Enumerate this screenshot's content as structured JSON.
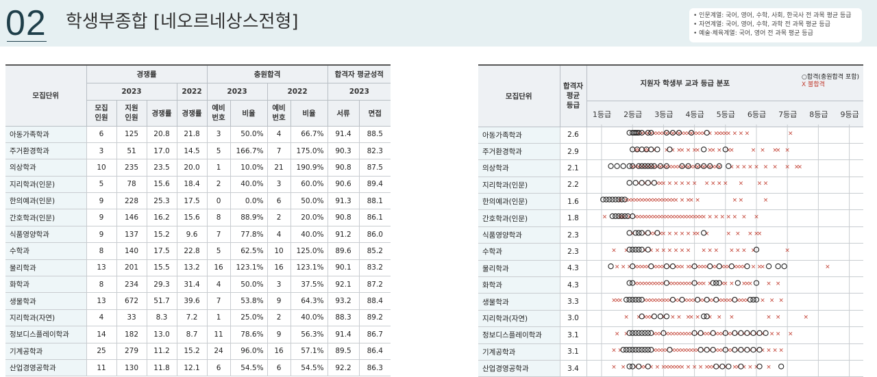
{
  "header": {
    "section_number": "02",
    "title": "학생부종합 [네오르네상스전형]",
    "notes": [
      "• 인문계열: 국어, 영어, 수학, 사회, 한국사 전 과목 평균 등급",
      "• 자연계열: 국어, 영어, 수학, 과학 전 과목 평균 등급",
      "• 예술·체육계열: 국어, 영어 전 과목 평균 등급"
    ]
  },
  "left_table": {
    "h_unit": "모집단위",
    "h_competition": "경쟁률",
    "h_additional": "충원합격",
    "h_avg": "합격자 평균성적",
    "h_2023a": "2023",
    "h_2022a": "2022",
    "h_2023b": "2023",
    "h_2022b": "2022",
    "h_2023c": "2023",
    "h_quota": "모집\n인원",
    "h_applicants": "지원\n인원",
    "h_rate": "경쟁률",
    "h_rate2022": "경쟁률",
    "h_wait": "예비\n번호",
    "h_ratio": "비율",
    "h_wait2022": "예비\n번호",
    "h_ratio2022": "비율",
    "h_doc": "서류",
    "h_interview": "면접",
    "rows": [
      [
        "아동가족학과",
        "6",
        "125",
        "20.8",
        "21.8",
        "3",
        "50.0%",
        "4",
        "66.7%",
        "91.4",
        "88.5"
      ],
      [
        "주거환경학과",
        "3",
        "51",
        "17.0",
        "14.5",
        "5",
        "166.7%",
        "7",
        "175.0%",
        "90.3",
        "82.3"
      ],
      [
        "의상학과",
        "10",
        "235",
        "23.5",
        "20.0",
        "1",
        "10.0%",
        "21",
        "190.9%",
        "90.8",
        "87.5"
      ],
      [
        "지리학과(인문)",
        "5",
        "78",
        "15.6",
        "18.4",
        "2",
        "40.0%",
        "3",
        "60.0%",
        "90.6",
        "89.4"
      ],
      [
        "한의예과(인문)",
        "9",
        "228",
        "25.3",
        "17.5",
        "0",
        "0.0%",
        "6",
        "50.0%",
        "91.3",
        "88.1"
      ],
      [
        "간호학과(인문)",
        "9",
        "146",
        "16.2",
        "15.6",
        "8",
        "88.9%",
        "2",
        "20.0%",
        "90.8",
        "86.1"
      ],
      [
        "식품영양학과",
        "9",
        "137",
        "15.2",
        "9.6",
        "7",
        "77.8%",
        "4",
        "40.0%",
        "91.2",
        "86.0"
      ],
      [
        "수학과",
        "8",
        "140",
        "17.5",
        "22.8",
        "5",
        "62.5%",
        "10",
        "125.0%",
        "89.6",
        "85.2"
      ],
      [
        "물리학과",
        "13",
        "201",
        "15.5",
        "13.2",
        "16",
        "123.1%",
        "16",
        "123.1%",
        "90.1",
        "83.2"
      ],
      [
        "화학과",
        "8",
        "234",
        "29.3",
        "31.4",
        "4",
        "50.0%",
        "3",
        "37.5%",
        "92.1",
        "87.2"
      ],
      [
        "생물학과",
        "13",
        "672",
        "51.7",
        "39.6",
        "7",
        "53.8%",
        "9",
        "64.3%",
        "93.2",
        "88.4"
      ],
      [
        "지리학과(자연)",
        "4",
        "33",
        "8.3",
        "7.2",
        "1",
        "25.0%",
        "2",
        "40.0%",
        "88.3",
        "89.2"
      ],
      [
        "정보디스플레이학과",
        "14",
        "182",
        "13.0",
        "8.7",
        "11",
        "78.6%",
        "9",
        "56.3%",
        "91.4",
        "86.7"
      ],
      [
        "기계공학과",
        "25",
        "279",
        "11.2",
        "15.2",
        "24",
        "96.0%",
        "16",
        "57.1%",
        "89.5",
        "86.4"
      ],
      [
        "산업경영공학과",
        "11",
        "130",
        "11.8",
        "12.1",
        "6",
        "54.5%",
        "6",
        "54.5%",
        "92.2",
        "86.3"
      ]
    ]
  },
  "right_table": {
    "h_unit": "모집단위",
    "h_avg_grade": "합격자\n평균\n등급",
    "h_dist": "지원자 학생부 교과 등급 분포",
    "legend_pass": "○합격(충원합격 포함)",
    "legend_fail": "X 불합격",
    "grade_labels": [
      "1등급",
      "2등급",
      "3등급",
      "4등급",
      "5등급",
      "6등급",
      "7등급",
      "8등급",
      "9등급"
    ],
    "rows": [
      [
        "아동가족학과",
        "2.6"
      ],
      [
        "주거환경학과",
        "2.9"
      ],
      [
        "의상학과",
        "2.1"
      ],
      [
        "지리학과(인문)",
        "2.2"
      ],
      [
        "한의예과(인문)",
        "1.6"
      ],
      [
        "간호학과(인문)",
        "1.8"
      ],
      [
        "식품영양학과",
        "2.3"
      ],
      [
        "수학과",
        "2.3"
      ],
      [
        "물리학과",
        "4.3"
      ],
      [
        "화학과",
        "4.3"
      ],
      [
        "생물학과",
        "3.3"
      ],
      [
        "지리학과(자연)",
        "3.0"
      ],
      [
        "정보디스플레이학과",
        "3.1"
      ],
      [
        "기계공학과",
        "3.1"
      ],
      [
        "산업경영공학과",
        "3.4"
      ]
    ]
  },
  "chart_data": {
    "type": "scatter",
    "title": "지원자 학생부 교과 등급 분포",
    "x_axis_labels": [
      "1등급",
      "2등급",
      "3등급",
      "4등급",
      "5등급",
      "6등급",
      "7등급",
      "8등급",
      "9등급"
    ],
    "xlim": [
      1,
      9
    ],
    "series": [
      {
        "name": "합격(충원합격 포함)",
        "marker": "circle",
        "color": "#222222"
      },
      {
        "name": "불합격",
        "marker": "x",
        "color": "#c0392b"
      }
    ],
    "rows": [
      {
        "unit": "아동가족학과",
        "pass": [
          1.9,
          2.0,
          2.05,
          2.1,
          2.15,
          2.2,
          2.3,
          2.5,
          2.6,
          3.1,
          3.3,
          3.5,
          3.9,
          4.4
        ],
        "fail": [
          2.2,
          2.3,
          2.4,
          2.5,
          2.6,
          2.7,
          2.8,
          2.9,
          3.0,
          3.1,
          3.2,
          3.3,
          3.4,
          3.5,
          3.6,
          3.7,
          3.8,
          3.9,
          4.0,
          4.1,
          4.2,
          4.3,
          4.5,
          4.7,
          4.8,
          4.9,
          5.0,
          5.1,
          5.3,
          5.5,
          5.7,
          7.1
        ]
      },
      {
        "unit": "주거환경학과",
        "pass": [
          2.0,
          2.15,
          2.3,
          2.45,
          2.6,
          2.8,
          3.2,
          4.3,
          5.0
        ],
        "fail": [
          2.1,
          2.2,
          2.4,
          2.5,
          2.7,
          3.1,
          3.3,
          3.5,
          3.6,
          3.8,
          4.0,
          4.1,
          4.5,
          4.6,
          4.8,
          5.1,
          5.2,
          5.9,
          6.2,
          6.6,
          6.7,
          7.0
        ]
      },
      {
        "unit": "의상학과",
        "pass": [
          1.3,
          1.5,
          1.7,
          1.9,
          2.0,
          2.2,
          2.3,
          2.4,
          2.5,
          2.6,
          2.7,
          2.9,
          3.1,
          3.6,
          3.8,
          4.1,
          4.3,
          4.5,
          4.8,
          5.1
        ],
        "fail": [
          2.0,
          2.1,
          2.2,
          2.3,
          2.4,
          2.5,
          2.6,
          2.7,
          2.8,
          2.9,
          3.0,
          3.1,
          3.2,
          3.3,
          3.4,
          3.5,
          3.6,
          3.7,
          3.8,
          3.9,
          4.0,
          4.1,
          4.2,
          4.3,
          4.4,
          4.5,
          4.6,
          4.7,
          4.8,
          5.2,
          5.4,
          5.6,
          5.8,
          6.0,
          6.3,
          6.6,
          7.0,
          7.3,
          7.4
        ]
      },
      {
        "unit": "지리학과(인문)",
        "pass": [
          1.9,
          2.1,
          2.3,
          2.5,
          2.7
        ],
        "fail": [
          2.2,
          2.4,
          2.6,
          2.8,
          2.9,
          3.0,
          3.2,
          3.4,
          3.6,
          3.8,
          4.0,
          4.4,
          4.6,
          4.8,
          5.0,
          5.5,
          6.1,
          6.3
        ]
      },
      {
        "unit": "한의예과(인문)",
        "pass": [
          1.05,
          1.15,
          1.25,
          1.35,
          1.45,
          1.55,
          1.65,
          1.75
        ],
        "fail": [
          1.6,
          1.8,
          1.9,
          2.0,
          2.1,
          2.2,
          2.3,
          2.4,
          2.5,
          2.6,
          2.7,
          2.8,
          2.9,
          3.0,
          3.1,
          3.2,
          3.3,
          3.4,
          3.6,
          3.8,
          3.9,
          4.1,
          5.3,
          5.5,
          6.3
        ]
      },
      {
        "unit": "간호학과(인문)",
        "pass": [
          1.35,
          1.45,
          1.55,
          1.65,
          1.75,
          1.85,
          2.0
        ],
        "fail": [
          1.1,
          1.6,
          1.7,
          1.9,
          2.1,
          2.2,
          2.3,
          2.4,
          2.5,
          2.6,
          2.7,
          2.8,
          2.9,
          3.0,
          3.1,
          3.2,
          3.3,
          3.4,
          3.5,
          3.6,
          3.7,
          3.8,
          3.9,
          4.0,
          4.1,
          4.2,
          4.3,
          4.5,
          4.7,
          4.9,
          5.1,
          5.3,
          5.6,
          6.0
        ]
      },
      {
        "unit": "식품영양학과",
        "pass": [
          1.9,
          2.1,
          2.2,
          2.3,
          2.5,
          2.8,
          4.3
        ],
        "fail": [
          2.0,
          2.4,
          2.6,
          2.7,
          2.9,
          3.0,
          3.2,
          3.4,
          3.6,
          3.8,
          4.0,
          4.1,
          4.4,
          5.1,
          5.4,
          5.8,
          6.0,
          6.1
        ]
      },
      {
        "unit": "수학과",
        "pass": [
          1.9,
          2.0,
          2.1,
          2.2,
          2.3,
          2.5,
          6.0
        ],
        "fail": [
          1.4,
          1.8,
          2.4,
          2.6,
          2.8,
          3.0,
          3.2,
          3.4,
          3.6,
          3.8,
          4.3,
          4.5,
          4.7,
          5.2,
          5.4,
          5.6,
          5.9,
          7.0
        ]
      },
      {
        "unit": "물리학과",
        "pass": [
          1.3,
          2.0,
          2.6,
          3.1,
          3.3,
          4.0,
          4.5,
          4.8,
          5.2,
          5.7,
          6.4,
          6.7,
          6.9
        ],
        "fail": [
          1.5,
          1.7,
          1.9,
          2.1,
          2.2,
          2.3,
          2.4,
          2.5,
          2.7,
          2.8,
          2.9,
          3.0,
          3.2,
          3.4,
          3.5,
          3.6,
          3.8,
          3.9,
          4.1,
          4.2,
          4.3,
          4.4,
          4.6,
          4.7,
          4.9,
          5.0,
          5.1,
          5.3,
          5.4,
          5.5,
          5.6,
          5.9,
          6.1,
          6.2,
          8.3
        ]
      },
      {
        "unit": "화학과",
        "pass": [
          1.9,
          2.0,
          3.1,
          4.0,
          4.6,
          4.7,
          4.8,
          5.4,
          6.0
        ],
        "fail": [
          2.1,
          2.2,
          2.3,
          2.4,
          2.5,
          2.6,
          2.7,
          2.8,
          2.9,
          3.0,
          3.2,
          3.3,
          3.4,
          3.5,
          3.6,
          3.7,
          3.8,
          3.9,
          4.1,
          4.2,
          4.3,
          4.5,
          4.9,
          5.0,
          5.2,
          5.6,
          5.7,
          5.8,
          6.4,
          6.7
        ]
      },
      {
        "unit": "생물학과",
        "pass": [
          1.8,
          1.9,
          2.0,
          2.1,
          2.2,
          2.3,
          3.3,
          3.6,
          4.1,
          4.4,
          4.7,
          5.3,
          5.8,
          5.9,
          6.0
        ],
        "fail": [
          1.4,
          1.5,
          1.6,
          2.4,
          2.5,
          2.6,
          2.7,
          2.8,
          2.9,
          3.0,
          3.1,
          3.2,
          3.4,
          3.5,
          3.7,
          3.8,
          3.9,
          4.0,
          4.2,
          4.3,
          4.5,
          4.6,
          4.8,
          4.9,
          5.0,
          5.1,
          5.2,
          5.4,
          5.5,
          5.6,
          5.7,
          6.2,
          6.5,
          6.8
        ]
      },
      {
        "unit": "지리학과(자연)",
        "pass": [
          2.3,
          2.7,
          2.9,
          3.1,
          4.3,
          4.4
        ],
        "fail": [
          1.8,
          2.2,
          2.4,
          2.5,
          2.6,
          3.0,
          3.3,
          3.5,
          3.8,
          3.9,
          4.1,
          4.5,
          4.8,
          5.2,
          6.4,
          6.7,
          7.6
        ]
      },
      {
        "unit": "정보디스플레이학과",
        "pass": [
          1.9,
          2.0,
          2.1,
          2.2,
          2.3,
          2.4,
          2.5,
          2.6,
          3.0,
          4.0,
          4.2,
          4.6,
          5.0,
          5.3,
          5.5,
          5.7,
          5.9,
          6.1,
          6.3
        ],
        "fail": [
          1.5,
          1.8,
          2.7,
          2.8,
          2.9,
          3.1,
          3.2,
          3.3,
          3.4,
          3.5,
          3.6,
          3.7,
          3.8,
          3.9,
          4.1,
          4.3,
          4.4,
          4.5,
          4.7,
          4.8,
          4.9,
          5.1,
          5.2,
          5.4,
          5.6,
          5.8,
          6.0,
          6.2,
          6.5,
          6.7,
          7.1
        ]
      },
      {
        "unit": "기계공학과",
        "pass": [
          1.7,
          1.8,
          1.9,
          2.0,
          2.1,
          2.2,
          2.3,
          2.4,
          2.5,
          2.6,
          3.2,
          4.2,
          4.4,
          4.6,
          5.0,
          5.3,
          5.5,
          5.7,
          5.9,
          6.1
        ],
        "fail": [
          1.4,
          1.6,
          2.7,
          2.8,
          2.9,
          3.0,
          3.1,
          3.3,
          3.4,
          3.5,
          3.6,
          3.7,
          3.8,
          3.9,
          4.0,
          4.1,
          4.3,
          4.5,
          4.7,
          4.8,
          4.9,
          5.1,
          5.2,
          5.4,
          5.6,
          5.8,
          6.0,
          6.2,
          6.4,
          6.6,
          6.8
        ]
      },
      {
        "unit": "산업경영공학과",
        "pass": [
          1.9,
          2.0,
          2.2,
          2.5,
          4.7,
          4.9,
          5.1,
          5.5,
          6.1,
          6.8
        ],
        "fail": [
          1.4,
          1.7,
          2.1,
          2.3,
          2.4,
          2.6,
          2.8,
          3.0,
          3.1,
          3.2,
          3.3,
          3.4,
          3.5,
          3.6,
          3.8,
          4.0,
          4.2,
          4.4,
          4.5,
          4.6,
          4.8,
          5.0,
          5.3,
          5.4,
          5.6,
          5.8,
          6.0,
          6.4
        ]
      }
    ]
  }
}
